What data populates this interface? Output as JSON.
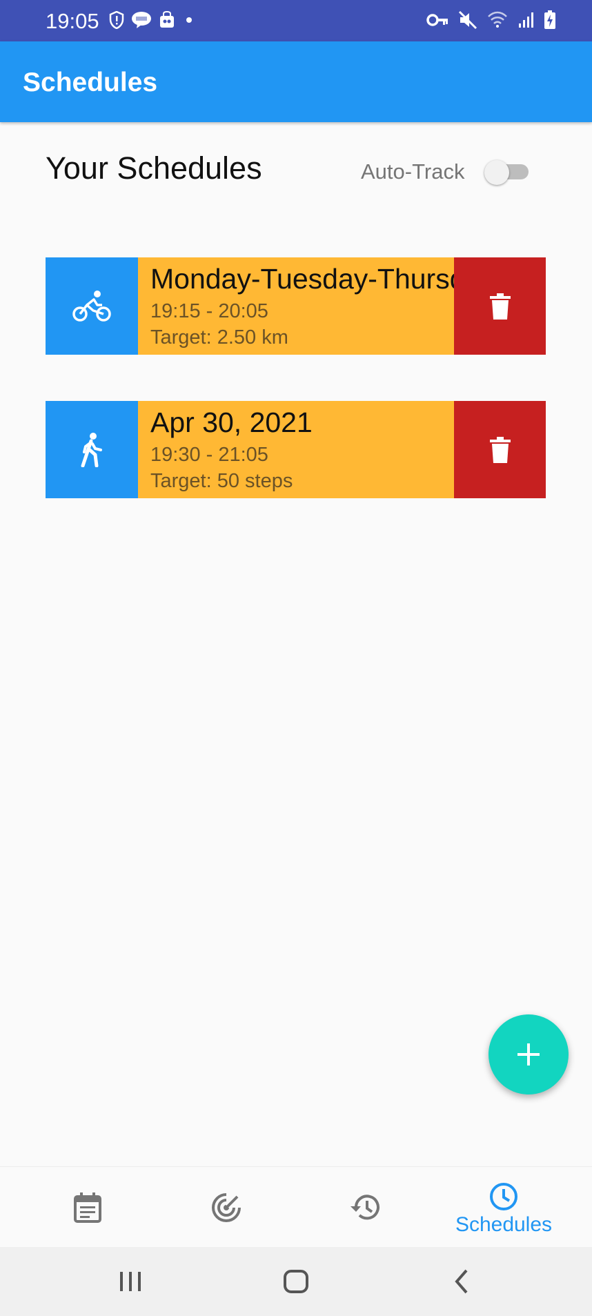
{
  "status_bar": {
    "time": "19:05",
    "left_icons": [
      "shield-icon",
      "line-app-icon",
      "bag-icon",
      "dot-icon"
    ],
    "right_icons": [
      "vpn-key-icon",
      "mute-icon",
      "wifi-icon",
      "signal-icon",
      "battery-charging-icon"
    ]
  },
  "app_bar": {
    "title": "Schedules"
  },
  "header": {
    "title": "Your Schedules",
    "auto_track_label": "Auto-Track",
    "auto_track_on": false
  },
  "schedules": [
    {
      "activity_icon": "bicycle-icon",
      "title": "Monday-Tuesday-Thursday",
      "time": "19:15 - 20:05",
      "target": "Target: 2.50 km"
    },
    {
      "activity_icon": "walking-icon",
      "title": "Apr 30, 2021",
      "time": "19:30 - 21:05",
      "target": "Target: 50 steps"
    }
  ],
  "fab": {
    "icon": "plus-icon"
  },
  "bottom_nav": {
    "items": [
      {
        "icon": "calendar-icon",
        "label": ""
      },
      {
        "icon": "target-icon",
        "label": ""
      },
      {
        "icon": "history-icon",
        "label": ""
      },
      {
        "icon": "clock-icon",
        "label": "Schedules",
        "active": true
      }
    ]
  },
  "colors": {
    "status_bar": "#3f51b5",
    "app_bar": "#2196f3",
    "card_body": "#ffb834",
    "delete": "#c62020",
    "fab": "#12d5c0",
    "active_nav": "#2196f3"
  }
}
